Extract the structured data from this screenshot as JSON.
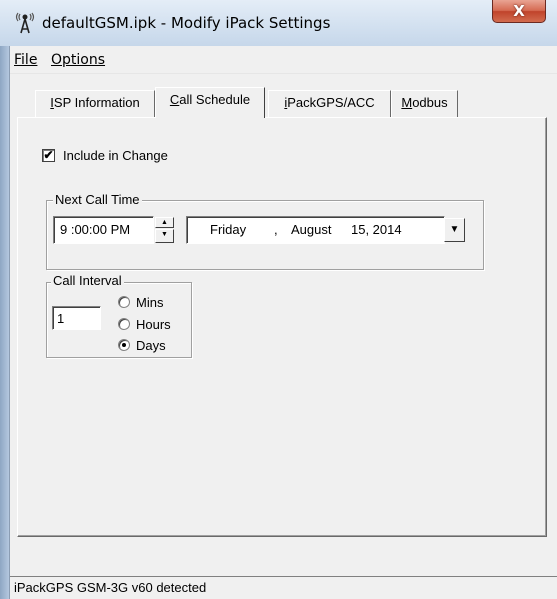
{
  "window": {
    "title": "defaultGSM.ipk - Modify iPack Settings",
    "close_glyph": "X",
    "app_icon": "antenna-icon"
  },
  "menu": {
    "items": [
      {
        "label": "File"
      },
      {
        "label": "Options"
      }
    ]
  },
  "tabs": [
    {
      "label": "ISP Information",
      "active": false
    },
    {
      "label": "Call Schedule",
      "active": true
    },
    {
      "label": "iPackGPS/ACC",
      "active": false
    },
    {
      "label": "Modbus",
      "active": false
    }
  ],
  "call_schedule": {
    "include_in_change": {
      "label": "Include in Change",
      "checked": true,
      "check_glyph": "✔"
    },
    "next_call_time": {
      "legend": "Next Call Time",
      "time_value": "9 :00:00 PM",
      "date": {
        "weekday": "Friday",
        "separator": ",",
        "month": "August",
        "day_year": "15, 2014"
      },
      "dropdown_glyph": "▼",
      "spin_up_glyph": "▲",
      "spin_down_glyph": "▼"
    },
    "call_interval": {
      "legend": "Call Interval",
      "value": "1",
      "options": [
        {
          "label": "Mins",
          "selected": false
        },
        {
          "label": "Hours",
          "selected": false
        },
        {
          "label": "Days",
          "selected": true
        }
      ]
    }
  },
  "status": {
    "text": "iPackGPS GSM-3G v60 detected"
  },
  "colors": {
    "close_button": "#c0432b",
    "dialog_bg": "#f0f0f0",
    "frame": "#b7cbe3"
  }
}
